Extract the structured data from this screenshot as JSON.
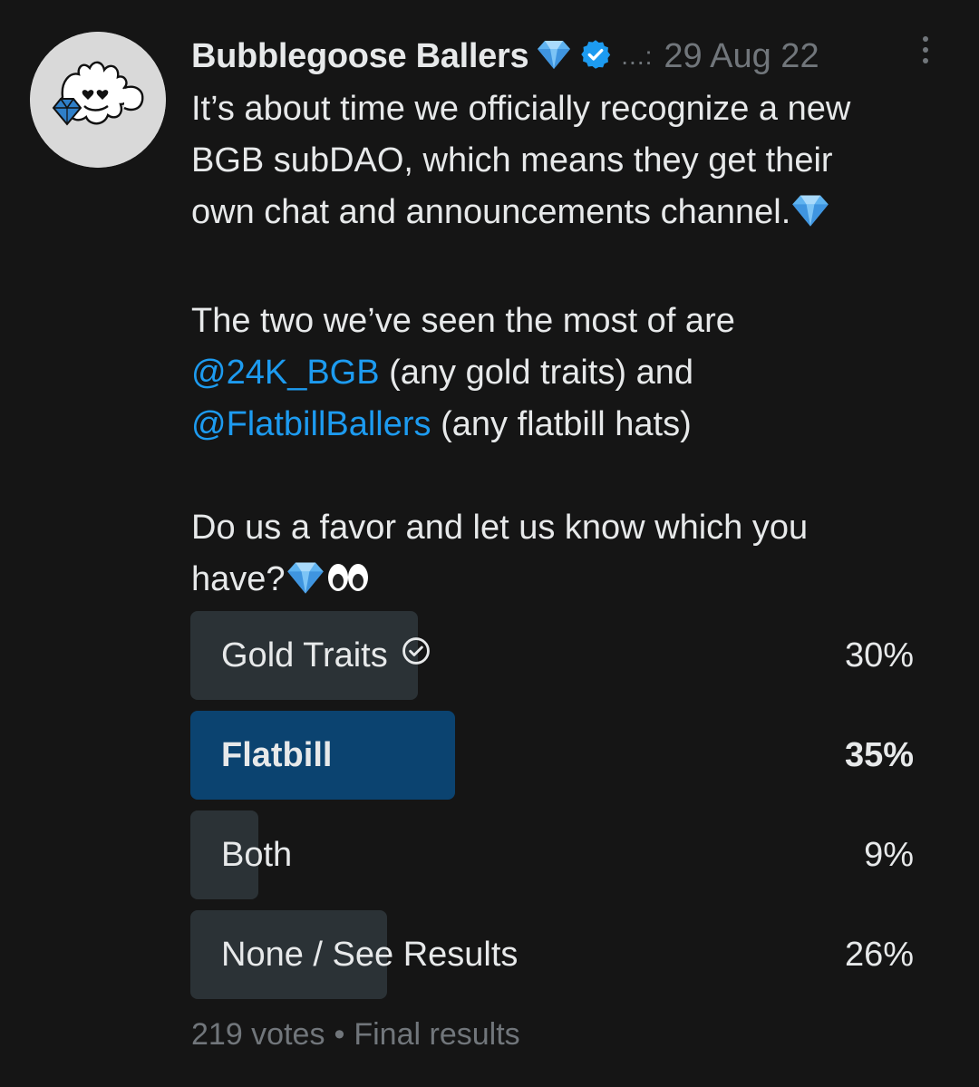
{
  "tweet": {
    "display_name": "Bubblegoose Ballers",
    "name_emoji_icon": "gem-icon",
    "verified_icon": "verified-badge-icon",
    "separator": "...:",
    "date": "29 Aug 22",
    "more_icon": "more-vertical-icon",
    "text": {
      "p1_l1": "It’s about time we officially recognize a new",
      "p1_l2": "BGB subDAO, which means they get their",
      "p1_l3": "own chat and announcements channel.",
      "p2_l1": "The two we’ve seen the most of are",
      "p2_l2_mention": "@24K_BGB",
      "p2_l2_rest": " (any gold traits) and",
      "p2_l3_mention": "@FlatbillBallers",
      "p2_l3_rest": " (any flatbill hats)",
      "p3_l1": "Do us a favor and let us know which you",
      "p3_l2": "have?"
    },
    "colors": {
      "background": "#151515",
      "text": "#e7e9ea",
      "muted": "#71767b",
      "mention": "#1d9bf0",
      "poll_bar": "#2b3236",
      "poll_winner_bar": "#0b4370"
    }
  },
  "poll": {
    "options": [
      {
        "label": "Gold Traits",
        "percent_label": "30%",
        "percent": 30,
        "user_voted": true,
        "winner": false
      },
      {
        "label": "Flatbill",
        "percent_label": "35%",
        "percent": 35,
        "user_voted": false,
        "winner": true
      },
      {
        "label": "Both",
        "percent_label": "9%",
        "percent": 9,
        "user_voted": false,
        "winner": false
      },
      {
        "label": "None / See Results",
        "percent_label": "26%",
        "percent": 26,
        "user_voted": false,
        "winner": false
      }
    ],
    "votes": "219 votes",
    "status": "Final results"
  }
}
